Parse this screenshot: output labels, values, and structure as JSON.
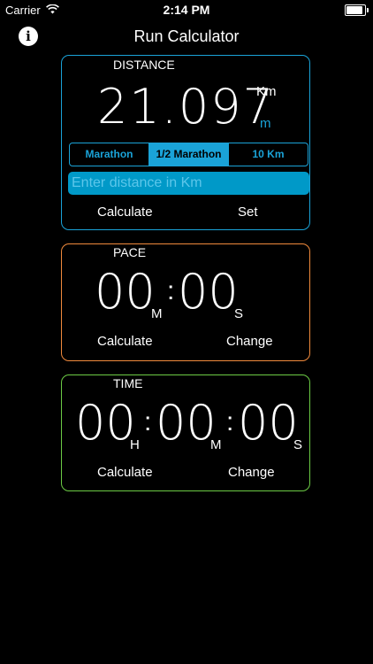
{
  "status_bar": {
    "carrier": "Carrier",
    "time": "2:14 PM"
  },
  "nav": {
    "title": "Run Calculator",
    "info_icon": "info-icon"
  },
  "distance": {
    "label": "DISTANCE",
    "value": "21.097",
    "unit_primary": "Km",
    "unit_secondary": "m",
    "presets": [
      {
        "label": "Marathon",
        "selected": false
      },
      {
        "label": "1/2 Marathon",
        "selected": true
      },
      {
        "label": "10 Km",
        "selected": false
      }
    ],
    "input_placeholder": "Enter distance in Km",
    "calculate_label": "Calculate",
    "set_label": "Set"
  },
  "pace": {
    "label": "PACE",
    "minutes": "00",
    "minutes_unit": "M",
    "seconds": "00",
    "seconds_unit": "S",
    "calculate_label": "Calculate",
    "change_label": "Change"
  },
  "time": {
    "label": "TIME",
    "hours": "00",
    "hours_unit": "H",
    "minutes": "00",
    "minutes_unit": "M",
    "seconds": "00",
    "seconds_unit": "S",
    "calculate_label": "Calculate",
    "change_label": "Change"
  },
  "colors": {
    "distance": "#1aa3d8",
    "pace": "#f08a3c",
    "time": "#6ccb45"
  }
}
